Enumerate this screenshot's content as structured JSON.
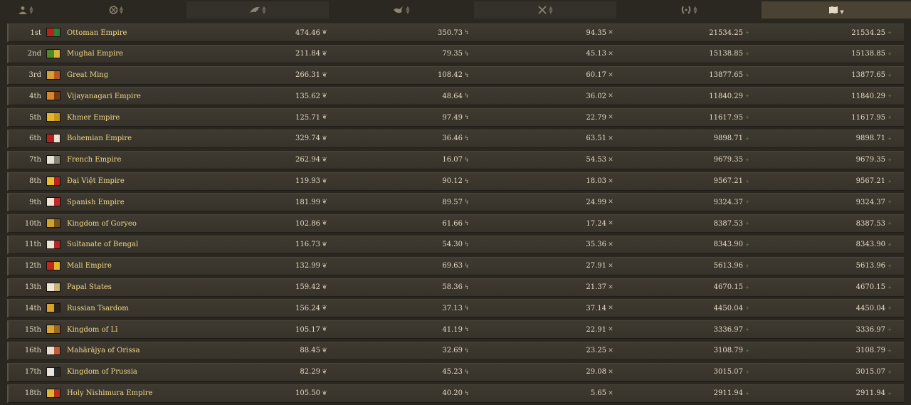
{
  "header": {
    "columns": [
      {
        "icon": "ruler-person-icon",
        "active": false
      },
      {
        "icon": "religion-symbol-icon",
        "active": false
      },
      {
        "icon": "wing-icon",
        "active": false
      },
      {
        "icon": "dove-icon",
        "active": false
      },
      {
        "icon": "crossed-swords-icon",
        "active": false
      },
      {
        "icon": "laurel-wreath-icon",
        "active": false
      },
      {
        "icon": "scroll-map-icon",
        "active": true,
        "sort": "descending"
      }
    ]
  },
  "rows": [
    {
      "rank": "1st",
      "country": "Ottoman Empire",
      "flag_colors": [
        "#b3241d",
        "#2e7d32"
      ],
      "v1": "474.46",
      "v2": "350.73",
      "v3": "94.35",
      "v4": "21534.25",
      "v5": "21534.25"
    },
    {
      "rank": "2nd",
      "country": "Mughal Empire",
      "flag_colors": [
        "#4c8a24",
        "#d6b43a"
      ],
      "v1": "211.84",
      "v2": "79.35",
      "v3": "45.13",
      "v4": "15138.85",
      "v5": "15138.85"
    },
    {
      "rank": "3rd",
      "country": "Great Ming",
      "flag_colors": [
        "#d8a033",
        "#b55a1e"
      ],
      "v1": "266.31",
      "v2": "108.42",
      "v3": "60.17",
      "v4": "13877.65",
      "v5": "13877.65"
    },
    {
      "rank": "4th",
      "country": "Vijayanagari Empire",
      "flag_colors": [
        "#d9862a",
        "#7a3a10"
      ],
      "v1": "135.62",
      "v2": "48.64",
      "v3": "36.02",
      "v4": "11840.29",
      "v5": "11840.29"
    },
    {
      "rank": "5th",
      "country": "Khmer Empire",
      "flag_colors": [
        "#e0b728",
        "#c79618"
      ],
      "v1": "125.71",
      "v2": "97.49",
      "v3": "22.79",
      "v4": "11617.95",
      "v5": "11617.95"
    },
    {
      "rank": "6th",
      "country": "Bohemian Empire",
      "flag_colors": [
        "#b52020",
        "#e8e2d0"
      ],
      "v1": "329.74",
      "v2": "36.46",
      "v3": "63.51",
      "v4": "9898.71",
      "v5": "9898.71"
    },
    {
      "rank": "7th",
      "country": "French Empire",
      "flag_colors": [
        "#e6e1d6",
        "#8a8478"
      ],
      "v1": "262.94",
      "v2": "16.07",
      "v3": "54.53",
      "v4": "9679.35",
      "v5": "9679.35"
    },
    {
      "rank": "8th",
      "country": "Đại Việt Empire",
      "flag_colors": [
        "#e6c02a",
        "#c0201a"
      ],
      "v1": "119.93",
      "v2": "90.12",
      "v3": "18.03",
      "v4": "9567.21",
      "v5": "9567.21"
    },
    {
      "rank": "9th",
      "country": "Spanish Empire",
      "flag_colors": [
        "#eee6d8",
        "#c22a2a"
      ],
      "v1": "181.99",
      "v2": "89.57",
      "v3": "24.99",
      "v4": "9324.37",
      "v5": "9324.37"
    },
    {
      "rank": "10th",
      "country": "Kingdom of Goryeo",
      "flag_colors": [
        "#d2a22e",
        "#7b5318"
      ],
      "v1": "102.86",
      "v2": "61.66",
      "v3": "17.24",
      "v4": "8387.53",
      "v5": "8387.53"
    },
    {
      "rank": "11th",
      "country": "Sultanate of Bengal",
      "flag_colors": [
        "#eae4d8",
        "#b3262a"
      ],
      "v1": "116.73",
      "v2": "54.30",
      "v3": "35.36",
      "v4": "8343.90",
      "v5": "8343.90"
    },
    {
      "rank": "12th",
      "country": "Mali Empire",
      "flag_colors": [
        "#c4261e",
        "#e3b52a"
      ],
      "v1": "132.99",
      "v2": "69.63",
      "v3": "27.91",
      "v4": "5613.96",
      "v5": "5613.96"
    },
    {
      "rank": "13th",
      "country": "Papal States",
      "flag_colors": [
        "#ece6d9",
        "#c9b37a"
      ],
      "v1": "159.42",
      "v2": "58.36",
      "v3": "21.37",
      "v4": "4670.15",
      "v5": "4670.15"
    },
    {
      "rank": "14th",
      "country": "Russian Tsardom",
      "flag_colors": [
        "#d6a126",
        "#2b2418"
      ],
      "v1": "156.24",
      "v2": "37.13",
      "v3": "37.14",
      "v4": "4450.04",
      "v5": "4450.04"
    },
    {
      "rank": "15th",
      "country": "Kingdom of Lĭ",
      "flag_colors": [
        "#d9a531",
        "#9b6a1c"
      ],
      "v1": "105.17",
      "v2": "41.19",
      "v3": "22.91",
      "v4": "3336.97",
      "v5": "3336.97"
    },
    {
      "rank": "16th",
      "country": "Mahārājya of Orissa",
      "flag_colors": [
        "#e7ddd0",
        "#c45c3a"
      ],
      "v1": "88.45",
      "v2": "32.69",
      "v3": "23.25",
      "v4": "3108.79",
      "v5": "3108.79"
    },
    {
      "rank": "17th",
      "country": "Kingdom of Prussia",
      "flag_colors": [
        "#e9e5dd",
        "#2a2a2a"
      ],
      "v1": "82.29",
      "v2": "45.23",
      "v3": "29.08",
      "v4": "3015.07",
      "v5": "3015.07"
    },
    {
      "rank": "18th",
      "country": "Holy Nishimura Empire",
      "flag_colors": [
        "#e2b431",
        "#b8301c"
      ],
      "v1": "105.50",
      "v2": "40.20",
      "v3": "5.65",
      "v4": "2911.94",
      "v5": "2911.94"
    }
  ]
}
